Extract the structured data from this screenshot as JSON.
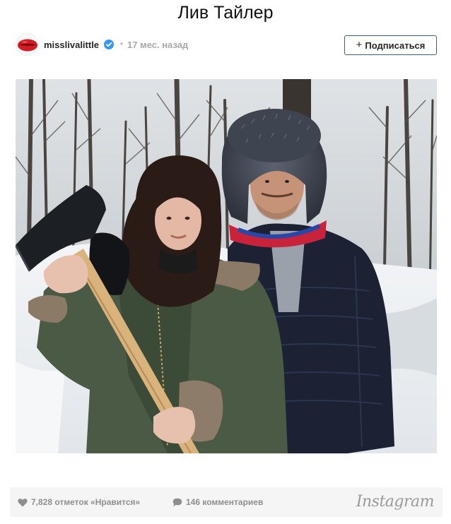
{
  "page": {
    "title": "Лив Тайлер"
  },
  "post": {
    "username": "misslivalittle",
    "separator": "•",
    "time_ago": "17 мес. назад",
    "follow_label": "Подписаться",
    "follow_prefix": "+"
  },
  "photo": {
    "subject": "woman holding an axe and a man in a fur trapper hat in a snowy forest"
  },
  "footer": {
    "likes_text": "7,828 отметок «Нравится»",
    "comments_text": "146 комментариев",
    "brand": "Instagram"
  },
  "colors": {
    "accent_border": "#3b5f7f",
    "verified": "#3897f0",
    "footer_bg": "#f5f5f5",
    "muted_text": "#8e8e8e"
  }
}
